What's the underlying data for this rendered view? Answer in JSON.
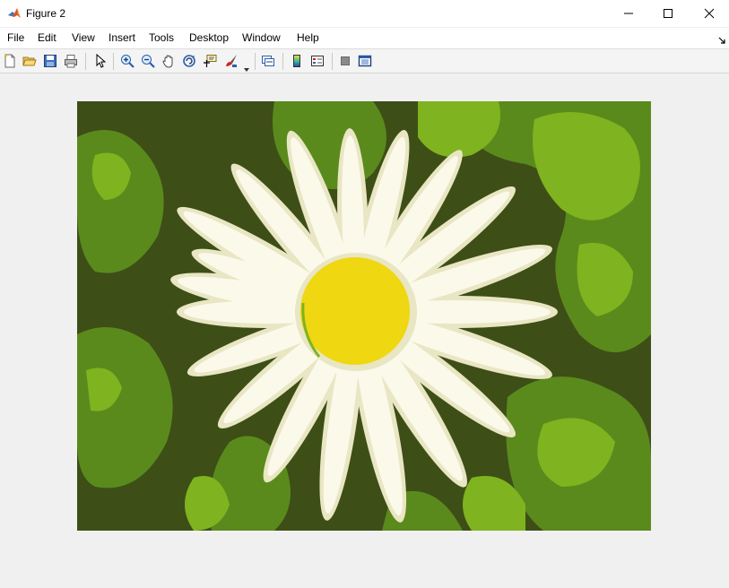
{
  "window": {
    "title": "Figure 2"
  },
  "menu": [
    "File",
    "Edit",
    "View",
    "Insert",
    "Tools",
    "Desktop",
    "Window",
    "Help"
  ],
  "toolbar": {
    "buttons": [
      "new-figure-icon",
      "open-file-icon",
      "save-icon",
      "print-icon",
      "edit-plot-arrow-icon",
      "zoom-in-icon",
      "zoom-out-icon",
      "pan-hand-icon",
      "rotate-3d-icon",
      "data-cursor-icon",
      "brush-icon",
      "link-plot-icon",
      "colorbar-icon",
      "legend-icon",
      "hide-plot-tools-icon",
      "show-plot-tools-icon"
    ]
  },
  "figure": {
    "content": "posterized photo of a white daisy with yellow center on green foliage",
    "colors": {
      "dark_green": "#3d4e17",
      "mid_green": "#5a8a1c",
      "light_green": "#7fb31f",
      "petal_white": "#fbf9ea",
      "petal_shade": "#e9e6c4",
      "center_yellow": "#efd711"
    }
  }
}
